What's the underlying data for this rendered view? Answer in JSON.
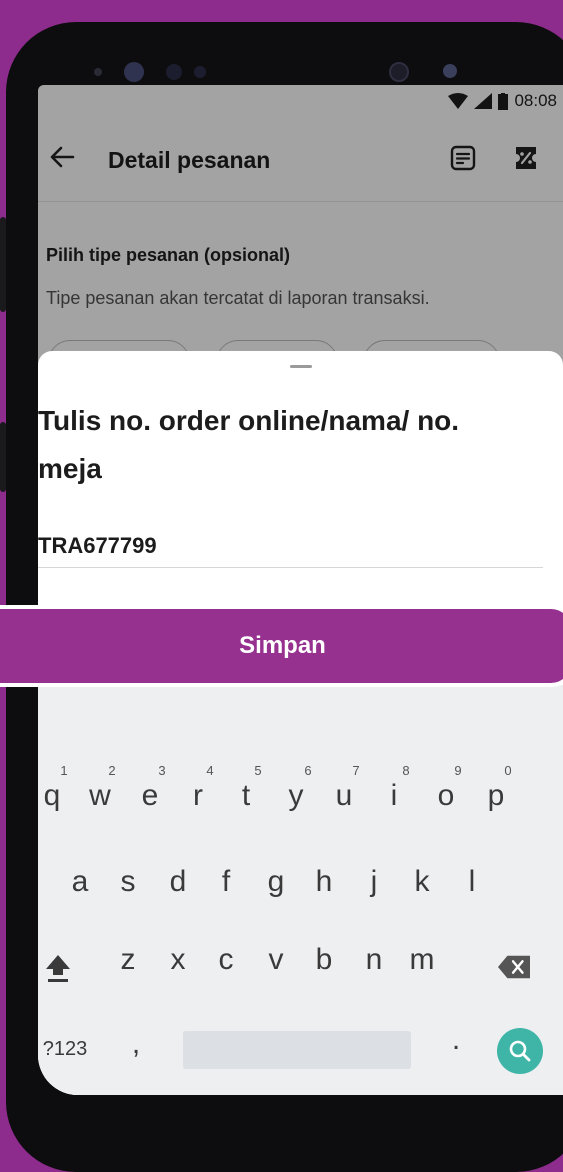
{
  "status_bar": {
    "time": "08:08"
  },
  "app_bar": {
    "title": "Detail pesanan"
  },
  "order_type": {
    "title": "Pilih tipe pesanan (opsional)",
    "description": "Tipe pesanan akan tercatat di laporan transaksi."
  },
  "sheet": {
    "title": "Tulis no. order online/nama/ no. meja",
    "input_value": "TRA677799"
  },
  "save_button": {
    "label": "Simpan"
  },
  "keyboard": {
    "row1": [
      "q",
      "w",
      "e",
      "r",
      "t",
      "y",
      "u",
      "i",
      "o",
      "p"
    ],
    "row1_hints": [
      "1",
      "2",
      "3",
      "4",
      "5",
      "6",
      "7",
      "8",
      "9",
      "0"
    ],
    "row2": [
      "a",
      "s",
      "d",
      "f",
      "g",
      "h",
      "j",
      "k",
      "l"
    ],
    "row3": [
      "z",
      "x",
      "c",
      "v",
      "b",
      "n",
      "m"
    ],
    "symbols_key": "?123",
    "comma_key": ",",
    "period_key": "."
  },
  "colors": {
    "brand": "#96318f",
    "search_key": "#3fb5a8"
  }
}
